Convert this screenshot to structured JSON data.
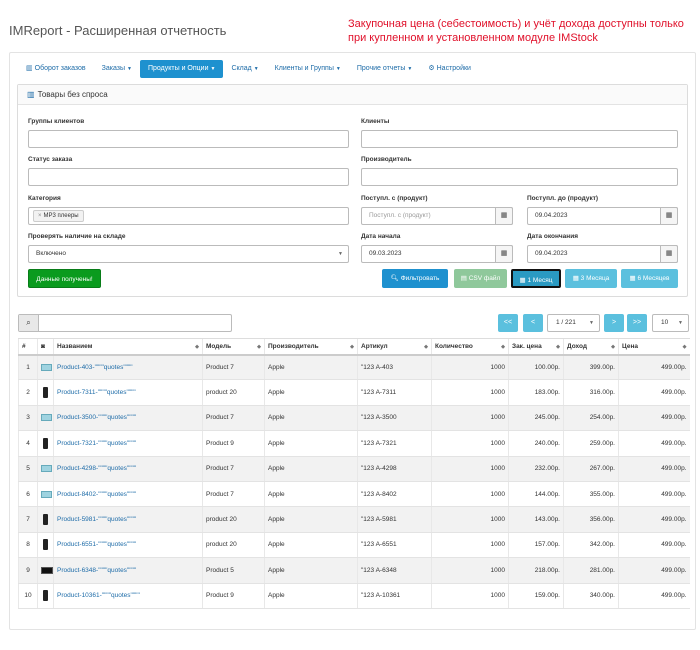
{
  "app_title": "IMReport - Расширенная отчетность",
  "notice": "Закупочная цена (себестоимость) и учёт дохода доступны только при купленном и установленном модуле IMStock",
  "nav": [
    {
      "label": "Оборот заказов",
      "icon": "bar-chart-icon",
      "caret": false,
      "active": false
    },
    {
      "label": "Заказы",
      "caret": true,
      "active": false
    },
    {
      "label": "Продукты и Опции",
      "caret": true,
      "active": true
    },
    {
      "label": "Склад",
      "caret": true,
      "active": false
    },
    {
      "label": "Клиенты и Группы",
      "caret": true,
      "active": false
    },
    {
      "label": "Прочие отчеты",
      "caret": true,
      "active": false
    },
    {
      "label": "Настройки",
      "icon": "gear-icon",
      "caret": false,
      "active": false
    }
  ],
  "panel": {
    "title": "Товары без спроса",
    "customer_groups_label": "Группы клиентов",
    "customers_label": "Клиенты",
    "order_status_label": "Статус заказа",
    "manufacturer_label": "Производитель",
    "category_label": "Категория",
    "category_chip": "MP3 плееры",
    "arrival_from_label": "Поступл. с (продукт)",
    "arrival_from_placeholder": "Поступл. с (продукт)",
    "arrival_to_label": "Поступл. до (продукт)",
    "arrival_to_value": "09.04.2023",
    "stock_check_label": "Проверять наличие на складе",
    "stock_check_value": "Включено",
    "date_start_label": "Дата начала",
    "date_start_value": "09.03.2023",
    "date_end_label": "Дата окончания",
    "date_end_value": "09.04.2023",
    "data_received_label": "Данные получены!",
    "filter_label": "Фильтровать",
    "csv_label": "CSV файл",
    "month1_label": "1 Месяц",
    "month3_label": "3 Месяца",
    "month6_label": "6 Месяцев"
  },
  "pagination": {
    "first": "<<",
    "prev": "<",
    "page": "1 / 221",
    "next": ">",
    "last": ">>",
    "per_page": "10"
  },
  "table": {
    "headers": [
      "#",
      "",
      "Названием",
      "Модель",
      "Производитель",
      "Артикул",
      "Количество",
      "Зак. цена",
      "Доход",
      "Цена"
    ],
    "rows": [
      {
        "n": "1",
        "thumb": "light",
        "name": "Product-403-\"\"\"\"quotes\"\"\"\"",
        "model": "Product 7",
        "manufacturer": "Apple",
        "sku": "\"123 A-403",
        "qty": "1000",
        "cost": "100.00р.",
        "income": "399.00р.",
        "price": "499.00р."
      },
      {
        "n": "2",
        "thumb": "dark",
        "name": "Product-7311-\"\"\"\"quotes\"\"\"\"",
        "model": "product 20",
        "manufacturer": "Apple",
        "sku": "\"123 A-7311",
        "qty": "1000",
        "cost": "183.00р.",
        "income": "316.00р.",
        "price": "499.00р."
      },
      {
        "n": "3",
        "thumb": "light",
        "name": "Product-3500-\"\"\"\"quotes\"\"\"\"",
        "model": "Product 7",
        "manufacturer": "Apple",
        "sku": "\"123 A-3500",
        "qty": "1000",
        "cost": "245.00р.",
        "income": "254.00р.",
        "price": "499.00р."
      },
      {
        "n": "4",
        "thumb": "dark",
        "name": "Product-7321-\"\"\"\"quotes\"\"\"\"",
        "model": "Product 9",
        "manufacturer": "Apple",
        "sku": "\"123 A-7321",
        "qty": "1000",
        "cost": "240.00р.",
        "income": "259.00р.",
        "price": "499.00р."
      },
      {
        "n": "5",
        "thumb": "light",
        "name": "Product-4298-\"\"\"\"quotes\"\"\"\"",
        "model": "Product 7",
        "manufacturer": "Apple",
        "sku": "\"123 A-4298",
        "qty": "1000",
        "cost": "232.00р.",
        "income": "267.00р.",
        "price": "499.00р."
      },
      {
        "n": "6",
        "thumb": "light",
        "name": "Product-8402-\"\"\"\"quotes\"\"\"\"",
        "model": "Product 7",
        "manufacturer": "Apple",
        "sku": "\"123 A-8402",
        "qty": "1000",
        "cost": "144.00р.",
        "income": "355.00р.",
        "price": "499.00р."
      },
      {
        "n": "7",
        "thumb": "dark",
        "name": "Product-5981-\"\"\"\"quotes\"\"\"\"",
        "model": "product 20",
        "manufacturer": "Apple",
        "sku": "\"123 A-5981",
        "qty": "1000",
        "cost": "143.00р.",
        "income": "356.00р.",
        "price": "499.00р."
      },
      {
        "n": "8",
        "thumb": "dark",
        "name": "Product-6551-\"\"\"\"quotes\"\"\"\"",
        "model": "product 20",
        "manufacturer": "Apple",
        "sku": "\"123 A-6551",
        "qty": "1000",
        "cost": "157.00р.",
        "income": "342.00р.",
        "price": "499.00р."
      },
      {
        "n": "9",
        "thumb": "red",
        "name": "Product-6348-\"\"\"\"quotes\"\"\"\"",
        "model": "Product 5",
        "manufacturer": "Apple",
        "sku": "\"123 A-6348",
        "qty": "1000",
        "cost": "218.00р.",
        "income": "281.00р.",
        "price": "499.00р."
      },
      {
        "n": "10",
        "thumb": "dark",
        "name": "Product-10361-\"\"\"\"quotes\"\"\"\"",
        "model": "Product 9",
        "manufacturer": "Apple",
        "sku": "\"123 A-10361",
        "qty": "1000",
        "cost": "159.00р.",
        "income": "340.00р.",
        "price": "499.00р."
      }
    ]
  }
}
